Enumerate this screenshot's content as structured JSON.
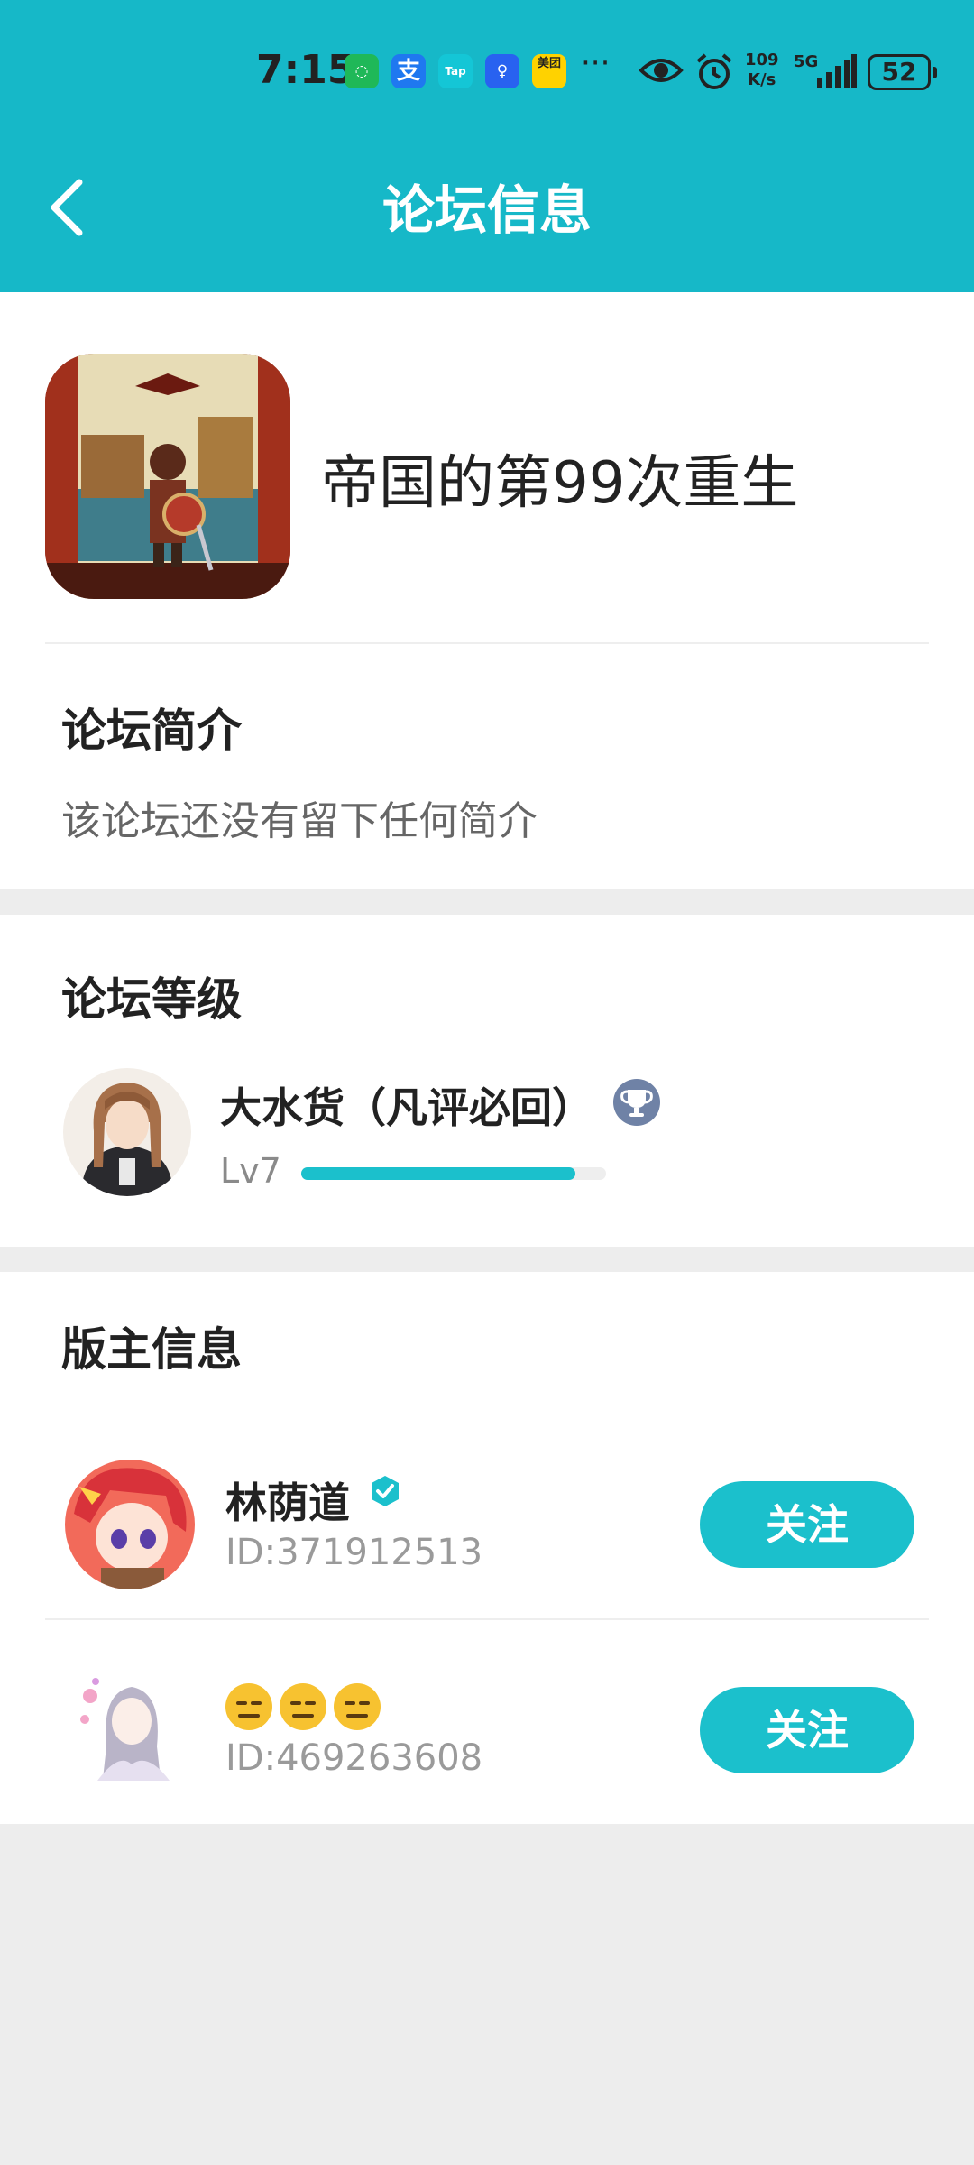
{
  "status_bar": {
    "time": "7:15",
    "apps": {
      "wechat": "◌",
      "alipay": "支",
      "tap": "Tap",
      "bulb": "♀",
      "meituan": "美团"
    },
    "more": "···",
    "net_speed_value": "109",
    "net_speed_unit": "K/s",
    "network": "5G",
    "battery": "52"
  },
  "header": {
    "title": "论坛信息"
  },
  "forum": {
    "name": "帝国的第99次重生"
  },
  "intro": {
    "heading": "论坛简介",
    "text": "该论坛还没有留下任何简介"
  },
  "level": {
    "heading": "论坛等级",
    "user_name": "大水货（凡评必回）",
    "level_label": "Lv7",
    "progress": 0.9
  },
  "moderators": {
    "heading": "版主信息",
    "items": [
      {
        "name": "林荫道",
        "id": "ID:371912513",
        "follow_label": "关注",
        "verified": true
      },
      {
        "name": "😑😑😑",
        "id": "ID:469263608",
        "follow_label": "关注",
        "verified": false
      }
    ]
  },
  "colors": {
    "brand": "#16b8c8",
    "button": "#1bc0cc",
    "trophy_badge": "#6f82a6"
  }
}
